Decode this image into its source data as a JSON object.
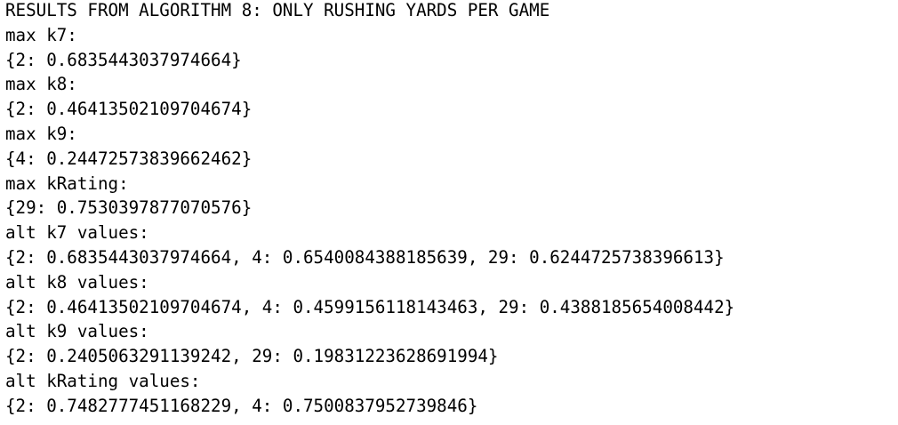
{
  "terminal": {
    "lines": [
      "RESULTS FROM ALGORITHM 8: ONLY RUSHING YARDS PER GAME",
      "max k7:",
      "{2: 0.6835443037974664}",
      "max k8:",
      "{2: 0.46413502109704674}",
      "max k9:",
      "{4: 0.24472573839662462}",
      "max kRating:",
      "{29: 0.7530397877070576}",
      "alt k7 values:",
      "{2: 0.6835443037974664, 4: 0.6540084388185639, 29: 0.6244725738396613}",
      "alt k8 values:",
      "{2: 0.46413502109704674, 4: 0.4599156118143463, 29: 0.4388185654008442}",
      "alt k9 values:",
      "{2: 0.2405063291139242, 29: 0.19831223628691994}",
      "alt kRating values:",
      "{2: 0.7482777451168229, 4: 0.7500837952739846}"
    ]
  }
}
